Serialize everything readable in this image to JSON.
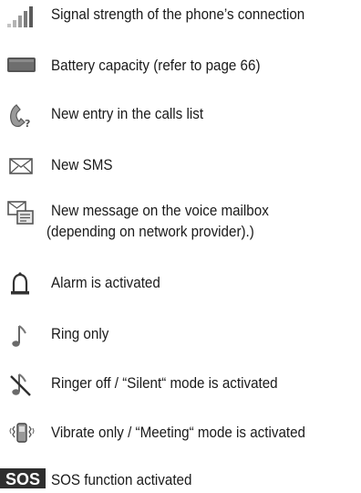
{
  "items": [
    {
      "icon": "signal-strength-icon",
      "text": "Signal strength of the phone’s connection"
    },
    {
      "icon": "battery-icon",
      "text": "Battery capacity (refer to page 66)"
    },
    {
      "icon": "missed-call-icon",
      "text": "New entry in the calls list"
    },
    {
      "icon": "envelope-icon",
      "text": "New SMS"
    },
    {
      "icon": "voicemail-icon",
      "text": "New message on the voice mailbox",
      "text2": "(depending on network provider).)"
    },
    {
      "icon": "alarm-bell-icon",
      "text": "Alarm is activated"
    },
    {
      "icon": "ring-note-icon",
      "text": "Ring only"
    },
    {
      "icon": "ringer-off-icon",
      "text": "Ringer off / “Silent“ mode is activated"
    },
    {
      "icon": "vibrate-icon",
      "text": "Vibrate only / “Meeting“ mode is activated"
    },
    {
      "icon": "sos-icon",
      "text": "SOS function activated"
    }
  ],
  "sos_badge": "SOS",
  "colors": {
    "text": "#1a1a1a",
    "icon_dark": "#2e2e2e",
    "icon_mid": "#777777",
    "icon_light": "#bdbdbd"
  }
}
